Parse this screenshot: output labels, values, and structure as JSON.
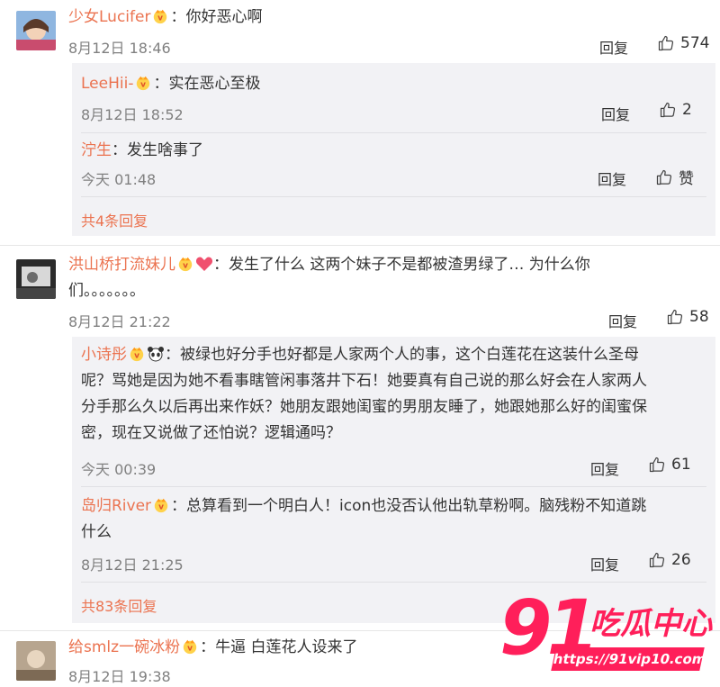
{
  "comments": [
    {
      "user": "少女Lucifer",
      "text": "：你好恶心啊",
      "time": "8月12日 18:46",
      "reply_label": "回复",
      "likes": "574",
      "replies": [
        {
          "user": "LeeHii-",
          "text": "：实在恶心至极",
          "time": "8月12日 18:52",
          "reply_label": "回复",
          "likes": "2"
        },
        {
          "user": "泞生",
          "text": "：发生啥事了",
          "time": "今天 01:48",
          "reply_label": "回复",
          "likes": "赞"
        }
      ],
      "more_replies": "共4条回复"
    },
    {
      "user": "洪山桥打流妹儿",
      "text_line1": "：发生了什么 这两个妹子不是都被渣男绿了… 为什么你",
      "text_line2": "们。。。。。。。",
      "time": "8月12日 21:22",
      "reply_label": "回复",
      "likes": "58",
      "replies": [
        {
          "user": "小诗彤",
          "text_lines": [
            "：被绿也好分手也好都是人家两个人的事，这个白莲花在这装什么圣母",
            "呢？骂她是因为她不看事瞎管闲事落井下石！她要真有自己说的那么好会在人家两人",
            "分手那么久以后再出来作妖？她朋友跟她闺蜜的男朋友睡了，她跟她那么好的闺蜜保",
            "密，现在又说做了还怕说？逻辑通吗？"
          ],
          "time": "今天 00:39",
          "reply_label": "回复",
          "likes": "61"
        },
        {
          "user": "岛归River",
          "text_lines": [
            "：总算看到一个明白人！icon也没否认他出轨草粉啊。脑残粉不知道跳",
            "什么"
          ],
          "time": "8月12日 21:25",
          "reply_label": "回复",
          "likes": "26"
        }
      ],
      "more_replies": "共83条回复"
    },
    {
      "user": "给smlz一碗冰粉",
      "text": "：牛逼 白莲花人设来了",
      "time": "8月12日 19:38"
    }
  ],
  "watermark": {
    "number": "91",
    "brand": "吃瓜中心",
    "url": "https://91vip10.com"
  },
  "colors": {
    "username": "#eb7350",
    "panel_bg": "#f2f2f5",
    "watermark": "#ff1f5a"
  }
}
